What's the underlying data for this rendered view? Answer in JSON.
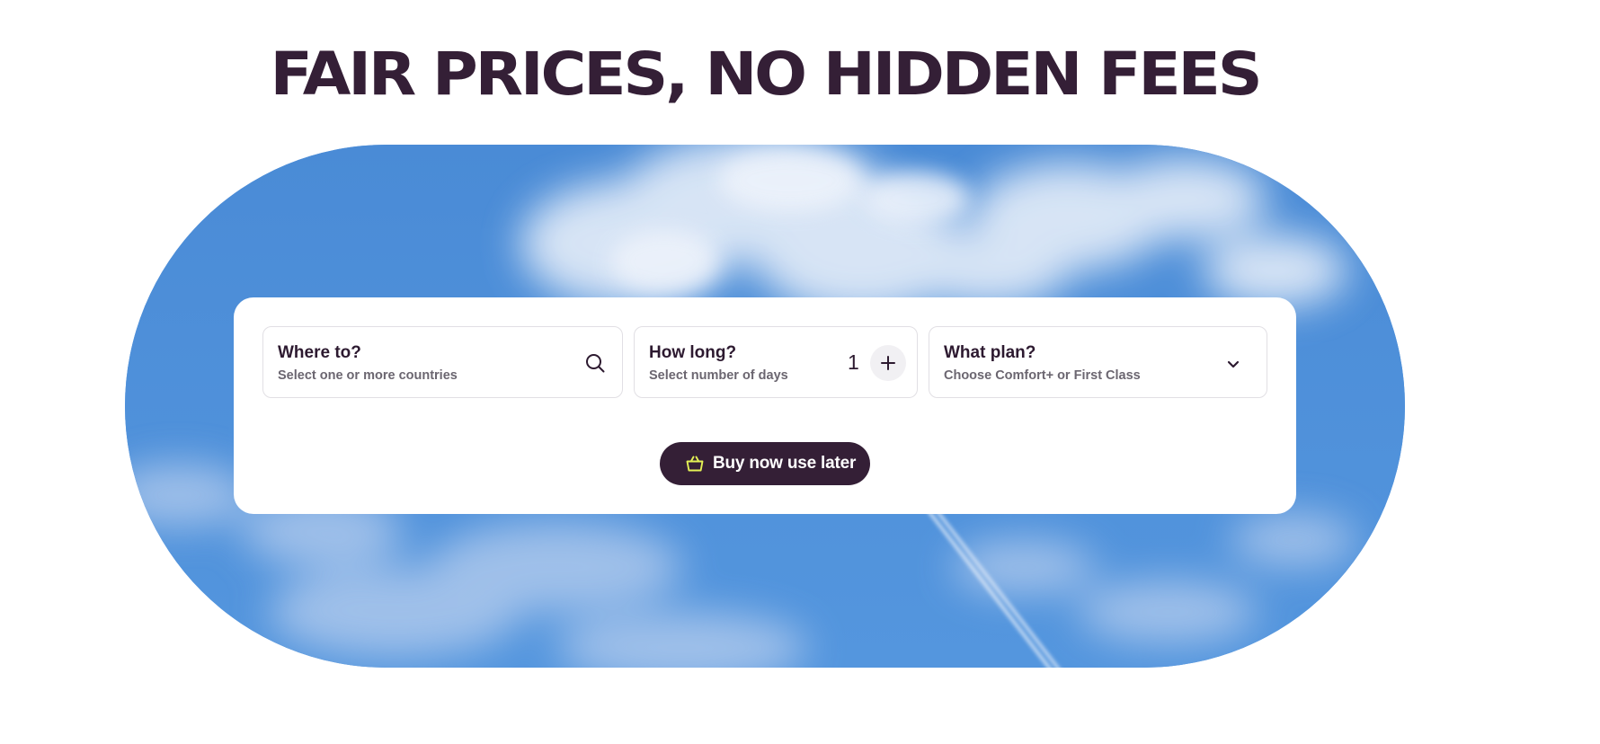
{
  "headline": "FAIR PRICES, NO HIDDEN FEES",
  "booking": {
    "destination": {
      "title": "Where to?",
      "subtitle": "Select one or more countries",
      "icon": "search-icon"
    },
    "duration": {
      "title": "How long?",
      "subtitle": "Select number of days",
      "days": "1",
      "increment_icon": "plus-icon"
    },
    "plan": {
      "title": "What plan?",
      "subtitle": "Choose Comfort+ or First Class",
      "icon": "chevron-down-icon"
    },
    "cta": {
      "label": "Buy now use later",
      "icon": "basket-icon"
    }
  },
  "colors": {
    "brand_dark": "#341f36",
    "accent_yellow": "#e4f255",
    "sky_blue": "#4f90d9"
  }
}
